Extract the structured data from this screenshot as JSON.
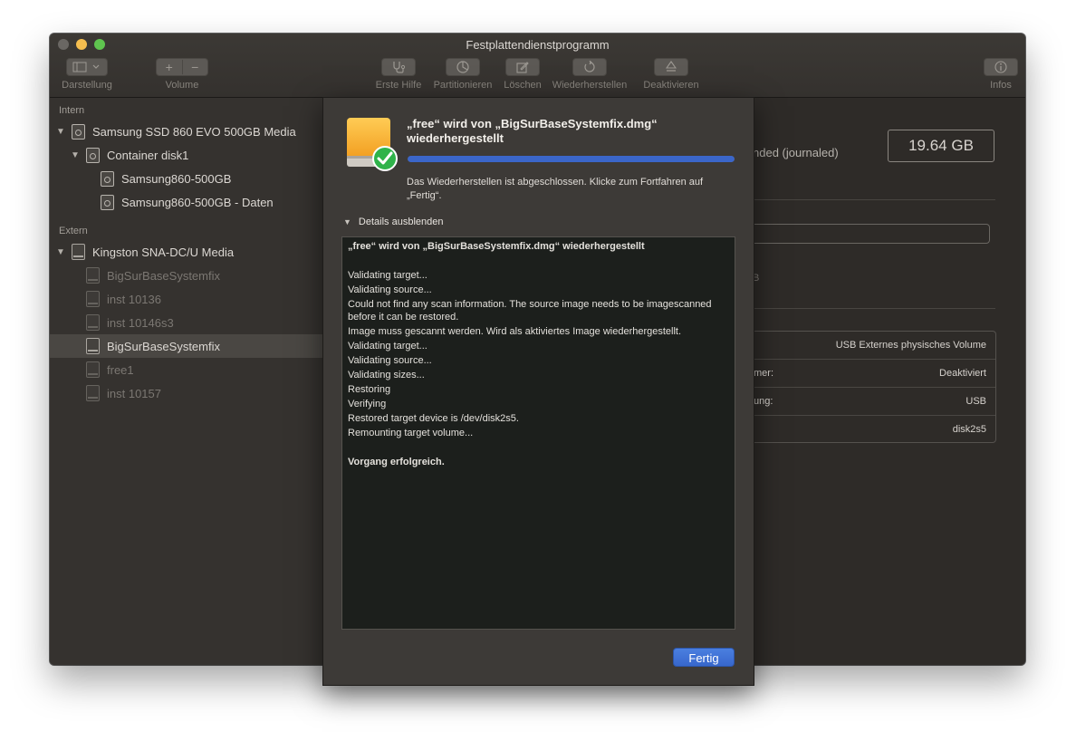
{
  "window": {
    "title": "Festplattendienstprogramm"
  },
  "toolbar": {
    "darstellung": "Darstellung",
    "volume": "Volume",
    "erste_hilfe": "Erste Hilfe",
    "partitionieren": "Partitionieren",
    "loeschen": "Löschen",
    "wiederherstellen": "Wiederherstellen",
    "deaktivieren": "Deaktivieren",
    "infos": "Infos"
  },
  "sidebar": {
    "intern_label": "Intern",
    "extern_label": "Extern",
    "items": [
      {
        "label": "Samsung SSD 860 EVO 500GB Media"
      },
      {
        "label": "Container disk1"
      },
      {
        "label": "Samsung860-500GB"
      },
      {
        "label": "Samsung860-500GB - Daten"
      },
      {
        "label": "Kingston SNA-DC/U Media"
      },
      {
        "label": "BigSurBaseSystemfix"
      },
      {
        "label": "inst 10136"
      },
      {
        "label": "inst 10146s3"
      },
      {
        "label": "BigSurBaseSystemfix"
      },
      {
        "label": "free1"
      },
      {
        "label": "inst 10157"
      }
    ]
  },
  "main": {
    "format_partial": "nded (journaled)",
    "capacity": "19.64 GB",
    "size_partial": "B",
    "info_rows": [
      {
        "key": "",
        "value": "USB Externes physisches Volume"
      },
      {
        "key": "mer:",
        "value": "Deaktiviert"
      },
      {
        "key": "ung:",
        "value": "USB"
      },
      {
        "key": "",
        "value": "disk2s5"
      }
    ]
  },
  "sheet": {
    "title": "„free“ wird von „BigSurBaseSystemfix.dmg“ wiederhergestellt",
    "progress": 1.0,
    "message": "Das Wiederherstellen ist abgeschlossen. Klicke zum Fortfahren auf „Fertig“.",
    "details_toggle": "Details ausblenden",
    "log": {
      "header": "„free“ wird von „BigSurBaseSystemfix.dmg“ wiederhergestellt",
      "lines": [
        "Validating target...",
        "Validating source...",
        "Could not find any scan information. The source image needs to be imagescanned before it can be restored.",
        "Image muss gescannt werden. Wird als aktiviertes Image wiederhergestellt.",
        "Validating target...",
        "Validating source...",
        "Validating sizes...",
        "Restoring",
        "Verifying",
        "Restored target device is /dev/disk2s5.",
        "Remounting target volume..."
      ],
      "result": "Vorgang erfolgreich."
    },
    "done_button": "Fertig"
  },
  "colors": {
    "accent": "#3767cc",
    "progress": "#3b66c9",
    "check": "#2fb34a",
    "drive_orange": "#f5a623"
  }
}
